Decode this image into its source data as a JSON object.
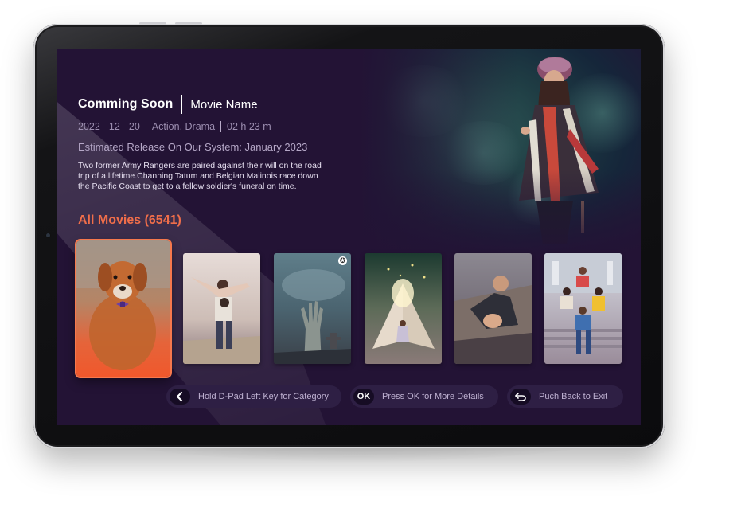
{
  "hero": {
    "title": "Comming Soon",
    "movie_name": "Movie Name",
    "date": "2022 - 12 - 20",
    "genres": "Action, Drama",
    "duration": "02 h 23 m",
    "release_line": "Estimated Release On Our System:  January 2023",
    "description": "Two former Army Rangers are paired against their will on the road trip of a lifetime.Channing Tatum and Belgian Malinois race down the Pacific Coast to get to a fellow soldier's funeral on time."
  },
  "section": {
    "title": "All Movies (6541)"
  },
  "posters": [
    {
      "subject": "dog-with-bow-tie",
      "selected": true
    },
    {
      "subject": "couple-piggyback",
      "selected": false
    },
    {
      "subject": "zombie-hand-graveyard",
      "selected": false,
      "badge": "star-icon"
    },
    {
      "subject": "girl-giant-book",
      "selected": false
    },
    {
      "subject": "man-climbing-cliff",
      "selected": false
    },
    {
      "subject": "friends-on-stairs",
      "selected": false
    }
  ],
  "hints": {
    "category": {
      "key_icon": "chevron-left-icon",
      "label": "Hold D-Pad Left Key for Category"
    },
    "details": {
      "key": "OK",
      "label": "Press OK for More Details"
    },
    "exit": {
      "key_icon": "back-arrow-icon",
      "label": "Puch Back to Exit"
    }
  },
  "colors": {
    "background": "#231335",
    "accent": "#f06e4a",
    "hint_pill": "#2e1f44",
    "text_muted": "#9d8fb1"
  }
}
